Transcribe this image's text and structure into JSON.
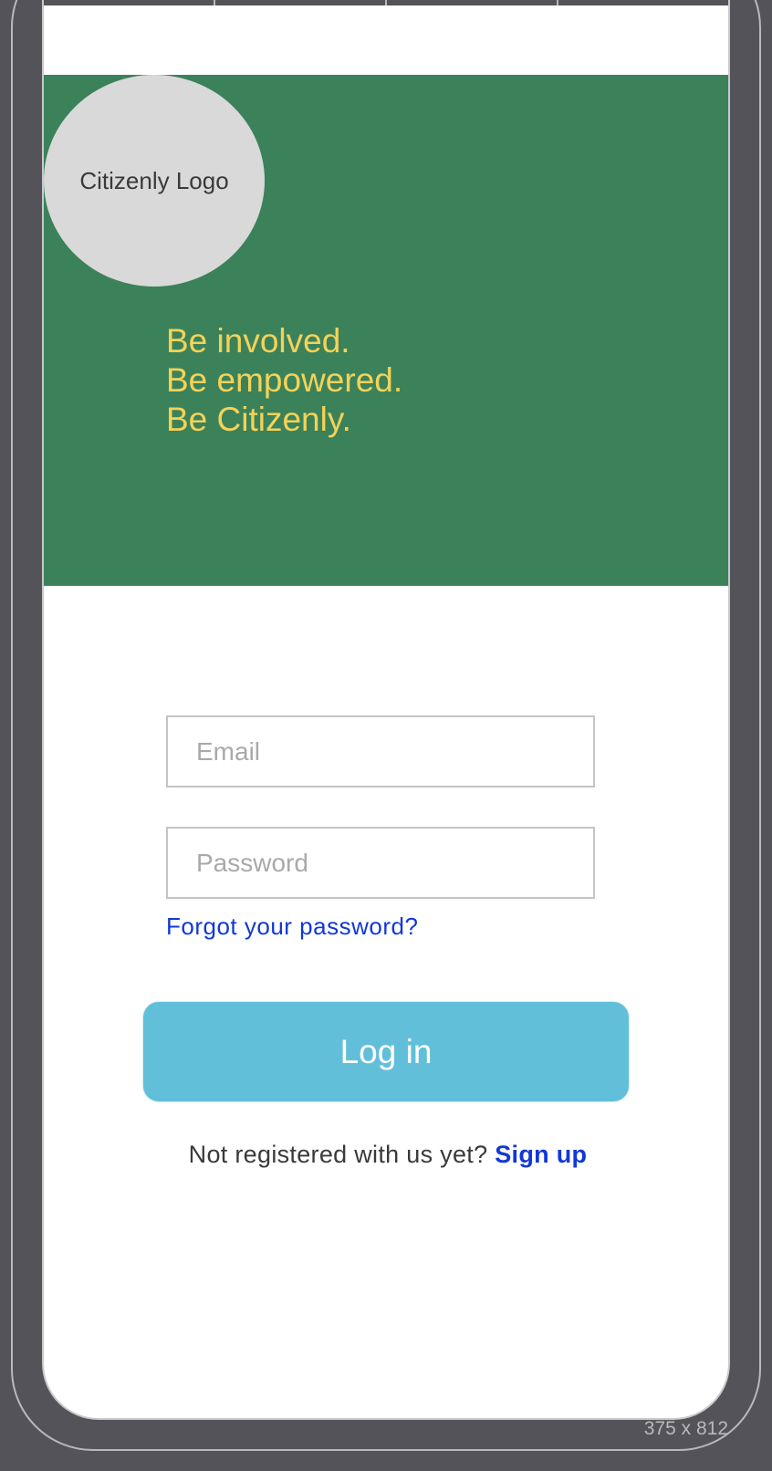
{
  "hero": {
    "logo_text": "Citizenly Logo",
    "tagline": [
      "Be involved.",
      "Be empowered.",
      "Be Citizenly."
    ]
  },
  "form": {
    "email_placeholder": "Email",
    "password_placeholder": "Password",
    "forgot_label": "Forgot your password?",
    "login_label": "Log in"
  },
  "signup": {
    "prompt": "Not registered with us yet?",
    "link_label": "Sign up"
  },
  "frame": {
    "dimensions_label": "375 x 812"
  },
  "colors": {
    "hero_bg": "#3b825a",
    "tagline": "#f5d257",
    "link": "#1138d6",
    "button_bg": "#62bfda",
    "logo_bg": "#d9d9d9"
  }
}
